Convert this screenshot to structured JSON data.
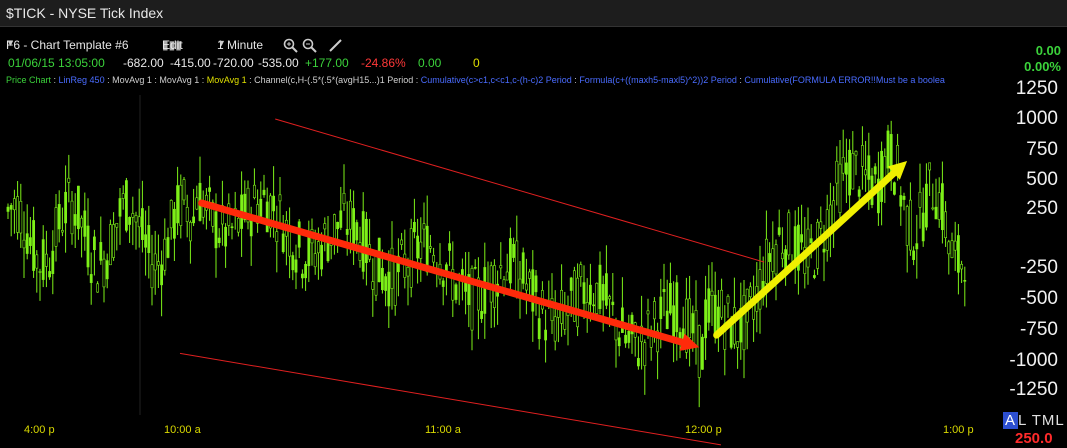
{
  "window": {
    "title": "$TICK - NYSE Tick Index"
  },
  "toolbar": {
    "template": "F6 - Chart Template #6",
    "edit": "Edit",
    "interval": "1 Minute"
  },
  "quote": {
    "datetime": "01/06/15 13:05:00",
    "open": "-682.00",
    "high": "-415.00",
    "low": "-720.00",
    "close": "-535.00",
    "change": "+177.00",
    "pct_change": "-24.86%",
    "val1": "0.00",
    "val2": "0",
    "right_change": "0.00",
    "right_pct": "0.00%"
  },
  "studies": [
    {
      "text": "Price Chart",
      "color": "#3bd23b"
    },
    {
      "text": " : ",
      "color": "#cfcfcf"
    },
    {
      "text": "LinReg 450",
      "color": "#4a6cff"
    },
    {
      "text": " : MovAvg 1 : MovAvg 1 : ",
      "color": "#cfcfcf"
    },
    {
      "text": "MovAvg 1",
      "color": "#e0e000"
    },
    {
      "text": " : Channel(c,H-(.5*(.5*(avgH15...)1 Period : ",
      "color": "#cfcfcf"
    },
    {
      "text": "Cumulative(c>c1,c<c1,c-(h-c)2 Period",
      "color": "#4a6cff"
    },
    {
      "text": " : ",
      "color": "#cfcfcf"
    },
    {
      "text": "Formula(c+((maxh5-maxl5)^2))2 Period",
      "color": "#4a6cff"
    },
    {
      "text": " : ",
      "color": "#cfcfcf"
    },
    {
      "text": "Cumulative(FORMULA ERROR!!Must be a boolea",
      "color": "#4a6cff"
    }
  ],
  "status": {
    "atml": [
      "A",
      "L",
      "T",
      "M",
      "L"
    ],
    "last_value": "250.0"
  },
  "chart_data": {
    "type": "candlestick",
    "y_axis": {
      "ticks": [
        1250,
        1000,
        750,
        500,
        250,
        -250,
        -500,
        -750,
        -1000,
        -1250
      ],
      "scale": "split (0 band omitted)"
    },
    "x_axis": {
      "ticks": [
        "4:00 p",
        "10:00 a",
        "11:00 a",
        "12:00 p",
        "1:00 p"
      ]
    },
    "channel": {
      "color": "#e02020",
      "upper": [
        {
          "t": "10:22 a",
          "v": 1000
        },
        {
          "t": "12:15 p",
          "v": -200
        }
      ],
      "lower": [
        {
          "t": "10:00 a",
          "v": -950
        },
        {
          "t": "12:05 p",
          "v": -1700
        }
      ]
    },
    "annotations": [
      {
        "type": "arrow",
        "color": "#ff2a0a",
        "from": {
          "t": "10:05 a",
          "v": 300
        },
        "to": {
          "t": "12:00 p",
          "v": -900
        }
      },
      {
        "type": "arrow",
        "color": "#f0f000",
        "from": {
          "t": "12:04 p",
          "v": -800
        },
        "to": {
          "t": "12:48 p",
          "v": 650
        }
      }
    ],
    "bar_color": "#7df018",
    "series_seed": 7
  }
}
